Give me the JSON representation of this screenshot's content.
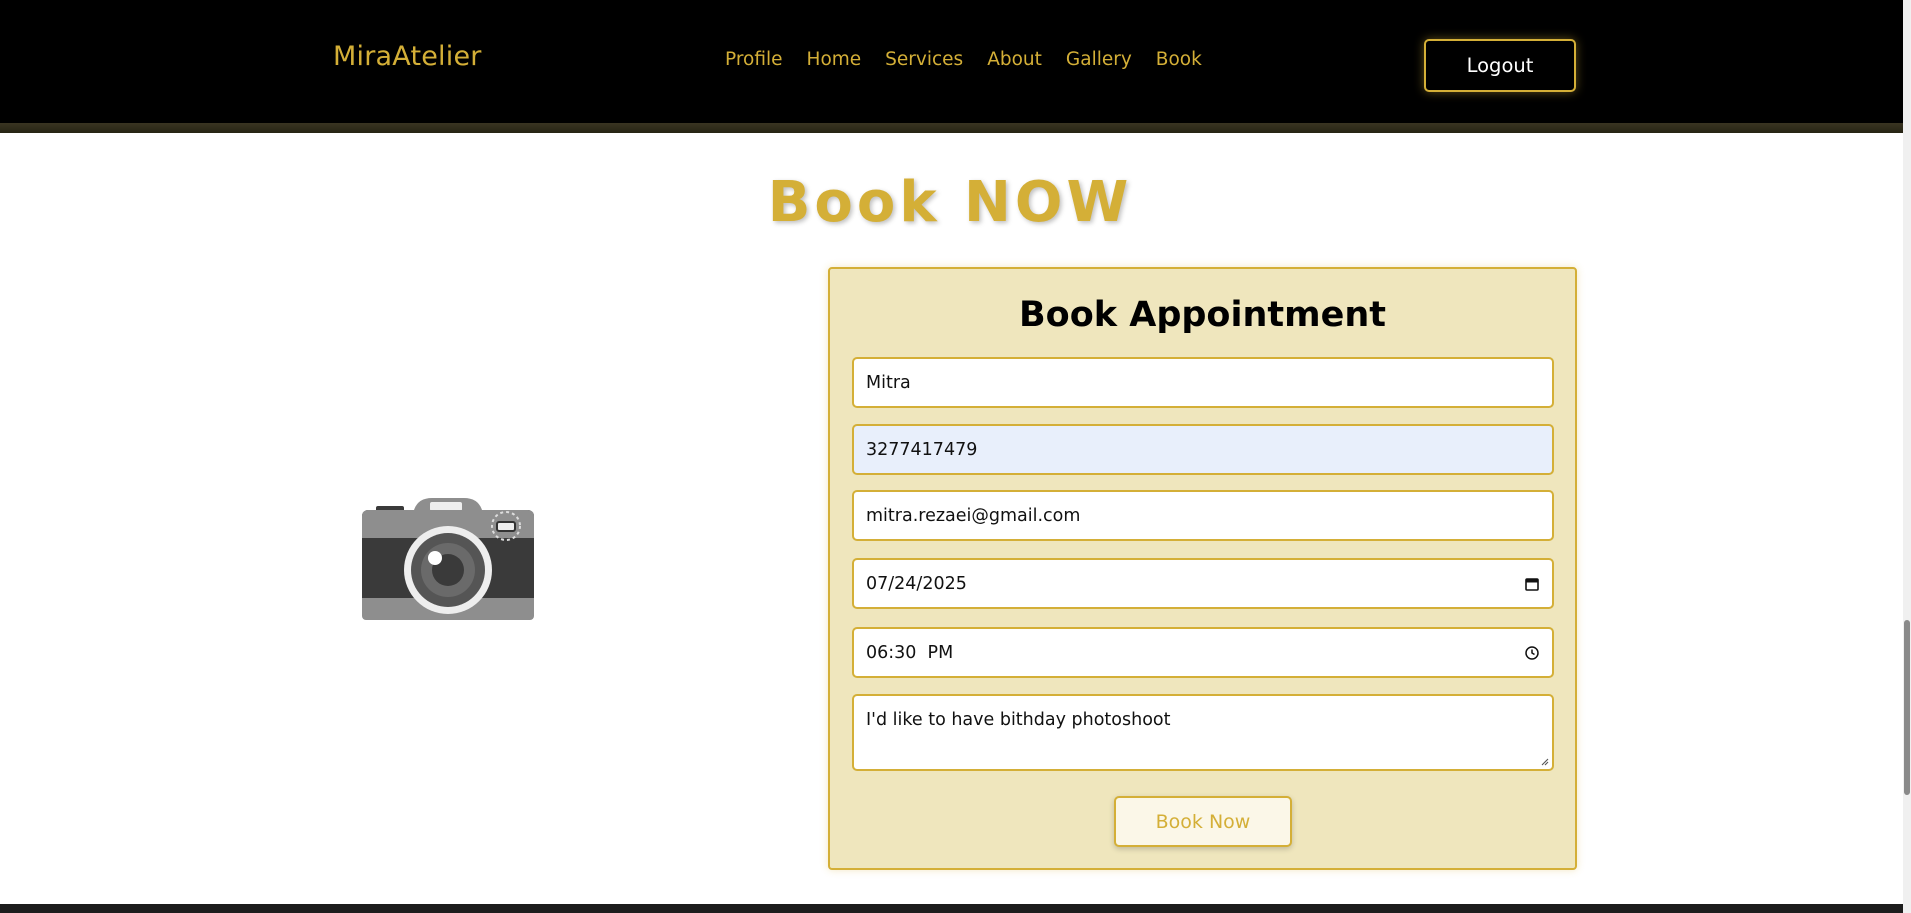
{
  "header": {
    "logo": "MiraAtelier",
    "nav": [
      {
        "label": "Profile"
      },
      {
        "label": "Home"
      },
      {
        "label": "Services"
      },
      {
        "label": "About"
      },
      {
        "label": "Gallery"
      },
      {
        "label": "Book"
      }
    ],
    "logout_label": "Logout"
  },
  "page": {
    "title": "Book NOW"
  },
  "form": {
    "title": "Book Appointment",
    "name_value": "Mitra",
    "phone_value": "3277417479",
    "email_value": "mitra.rezaei@gmail.com",
    "date_value": "07/24/2025",
    "time_value": "06:30  PM",
    "message_value": "I'd like to have bithday photoshoot",
    "submit_label": "Book Now"
  },
  "icons": {
    "illustration": "camera-icon",
    "date": "calendar-icon",
    "time": "clock-icon"
  },
  "colors": {
    "accent": "#d4af37",
    "header_bg": "#000000",
    "card_bg": "#efe6bd",
    "autofill_bg": "#e8effb"
  }
}
